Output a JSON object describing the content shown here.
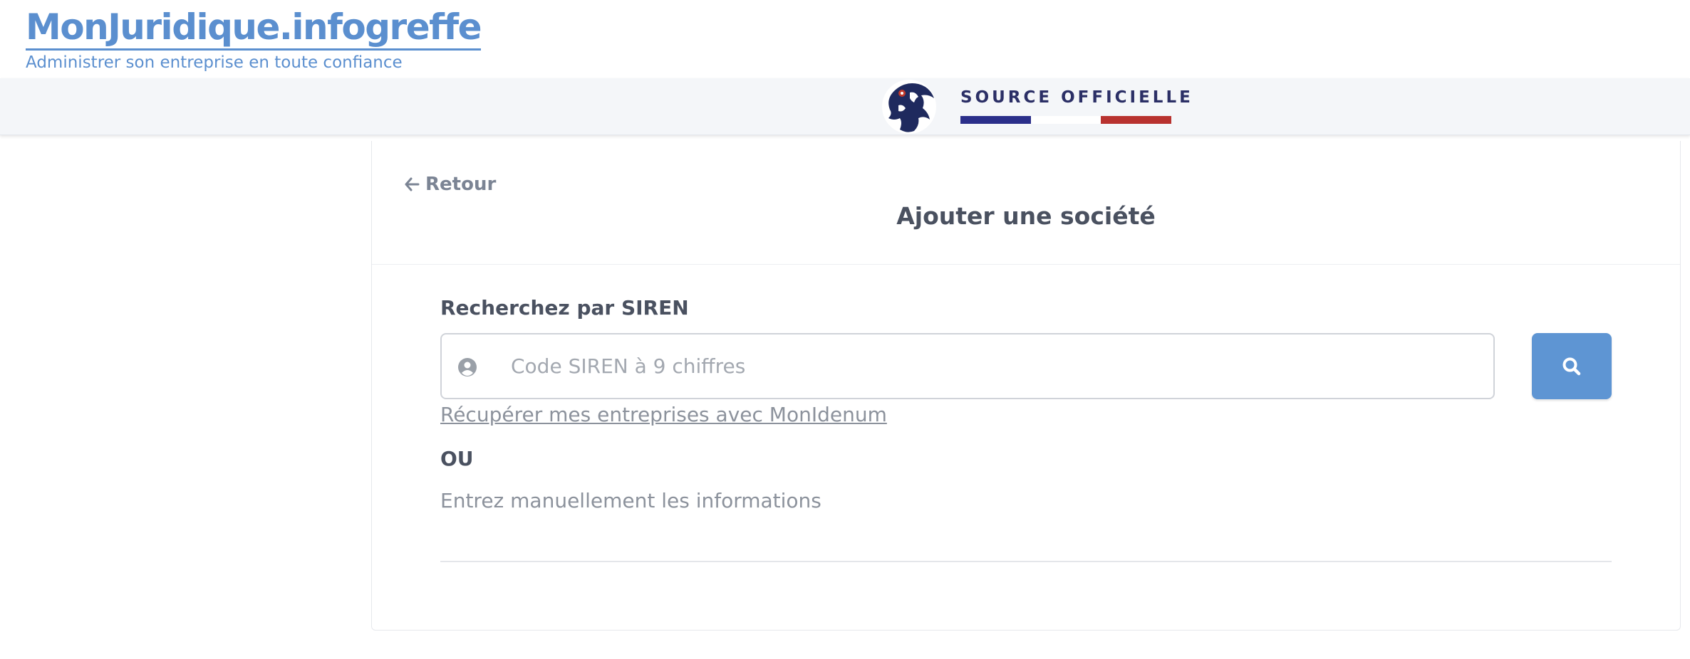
{
  "brand": {
    "title": "MonJuridique.infogreffe",
    "tagline": "Administrer son entreprise en toute confiance",
    "color": "#5b8fcf"
  },
  "official_banner": {
    "text": "SOURCE OFFICIELLE",
    "flag_colors": [
      "#2b2f8a",
      "#ffffff",
      "#b8322f"
    ]
  },
  "page": {
    "back_label": "Retour",
    "title": "Ajouter une société"
  },
  "siren_search": {
    "label": "Recherchez par SIREN",
    "value": "",
    "placeholder": "Code SIREN à 9 chiffres",
    "field_icon": "user-circle-icon",
    "button_icon": "search-icon",
    "button_color": "#5e95d3"
  },
  "idenum_link": "Récupérer mes entreprises avec MonIdenum",
  "or_label": "OU",
  "manual_link": "Entrez manuellement les informations"
}
